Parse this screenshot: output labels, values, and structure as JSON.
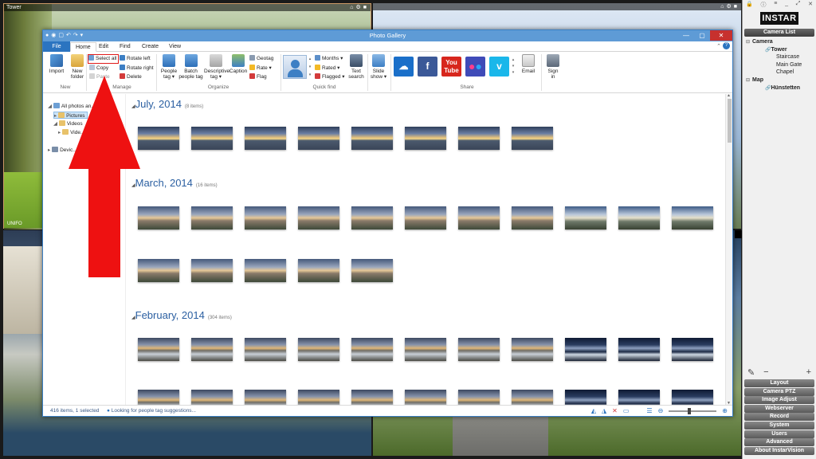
{
  "cameras": {
    "top_left": {
      "title": "Tower",
      "footer": "UNIFO"
    },
    "top_right": {
      "title": ""
    }
  },
  "panel": {
    "logo": "INSTAR",
    "header": "Camera List",
    "tree": [
      {
        "label": "Camera",
        "level": 0,
        "expander": "⊟"
      },
      {
        "label": "Tower",
        "level": 1,
        "icon": "🔗",
        "bold": true
      },
      {
        "label": "Staircase",
        "level": 1
      },
      {
        "label": "Main Gate",
        "level": 1
      },
      {
        "label": "Chapel",
        "level": 1
      },
      {
        "label": "Map",
        "level": 0,
        "expander": "⊟"
      },
      {
        "label": "Hünstetten",
        "level": 1,
        "icon": "🔗",
        "bold": true
      }
    ],
    "tools": {
      "edit": "✎",
      "minus": "−",
      "plus": "+"
    },
    "menu": [
      "Layout",
      "Camera PTZ",
      "Image Adjust",
      "Webserver",
      "Record",
      "System",
      "Users",
      "Advanced",
      "About InstarVision"
    ]
  },
  "window": {
    "title": "Photo Gallery",
    "tabs": [
      "File",
      "Home",
      "Edit",
      "Find",
      "Create",
      "View"
    ],
    "ribbon": {
      "new": {
        "import": "Import",
        "new_folder_1": "New",
        "new_folder_2": "folder",
        "label": "New"
      },
      "manage": {
        "select_all": "Select all",
        "copy": "Copy",
        "paste": "Paste",
        "rotate_left": "Rotate left",
        "rotate_right": "Rotate right",
        "delete": "Delete",
        "label": "Manage"
      },
      "organize": {
        "people_1": "People",
        "people_2": "tag ▾",
        "batch_1": "Batch",
        "batch_2": "people tag",
        "desc_1": "Descriptive",
        "desc_2": "tag ▾",
        "caption": "Caption",
        "geotag": "Geotag",
        "rate": "Rate ▾",
        "flag": "Flag",
        "label": "Organize"
      },
      "quickfind": {
        "months": "Months ▾",
        "rated": "Rated ▾",
        "flagged": "Flagged ▾",
        "text_1": "Text",
        "text_2": "search",
        "label": "Quick find"
      },
      "slideshow": {
        "line1": "Slide",
        "line2": "show ▾"
      },
      "share": {
        "email": "Email",
        "label": "Share"
      },
      "signin": {
        "line1": "Sign",
        "line2": "in"
      }
    },
    "nav": [
      {
        "label": "All photos an..."
      },
      {
        "label": "Pictures"
      },
      {
        "label": "Videos"
      },
      {
        "label": "Vide..."
      },
      {
        "label": "Devic..."
      }
    ],
    "groups": [
      {
        "title": "July, 2014",
        "count": "(8 items)"
      },
      {
        "title": "March, 2014",
        "count": "(16 items)"
      },
      {
        "title": "February, 2014",
        "count": "(304 items)"
      }
    ],
    "status": {
      "items": "416 items, 1 selected",
      "message": "Looking for people tag suggestions..."
    }
  }
}
